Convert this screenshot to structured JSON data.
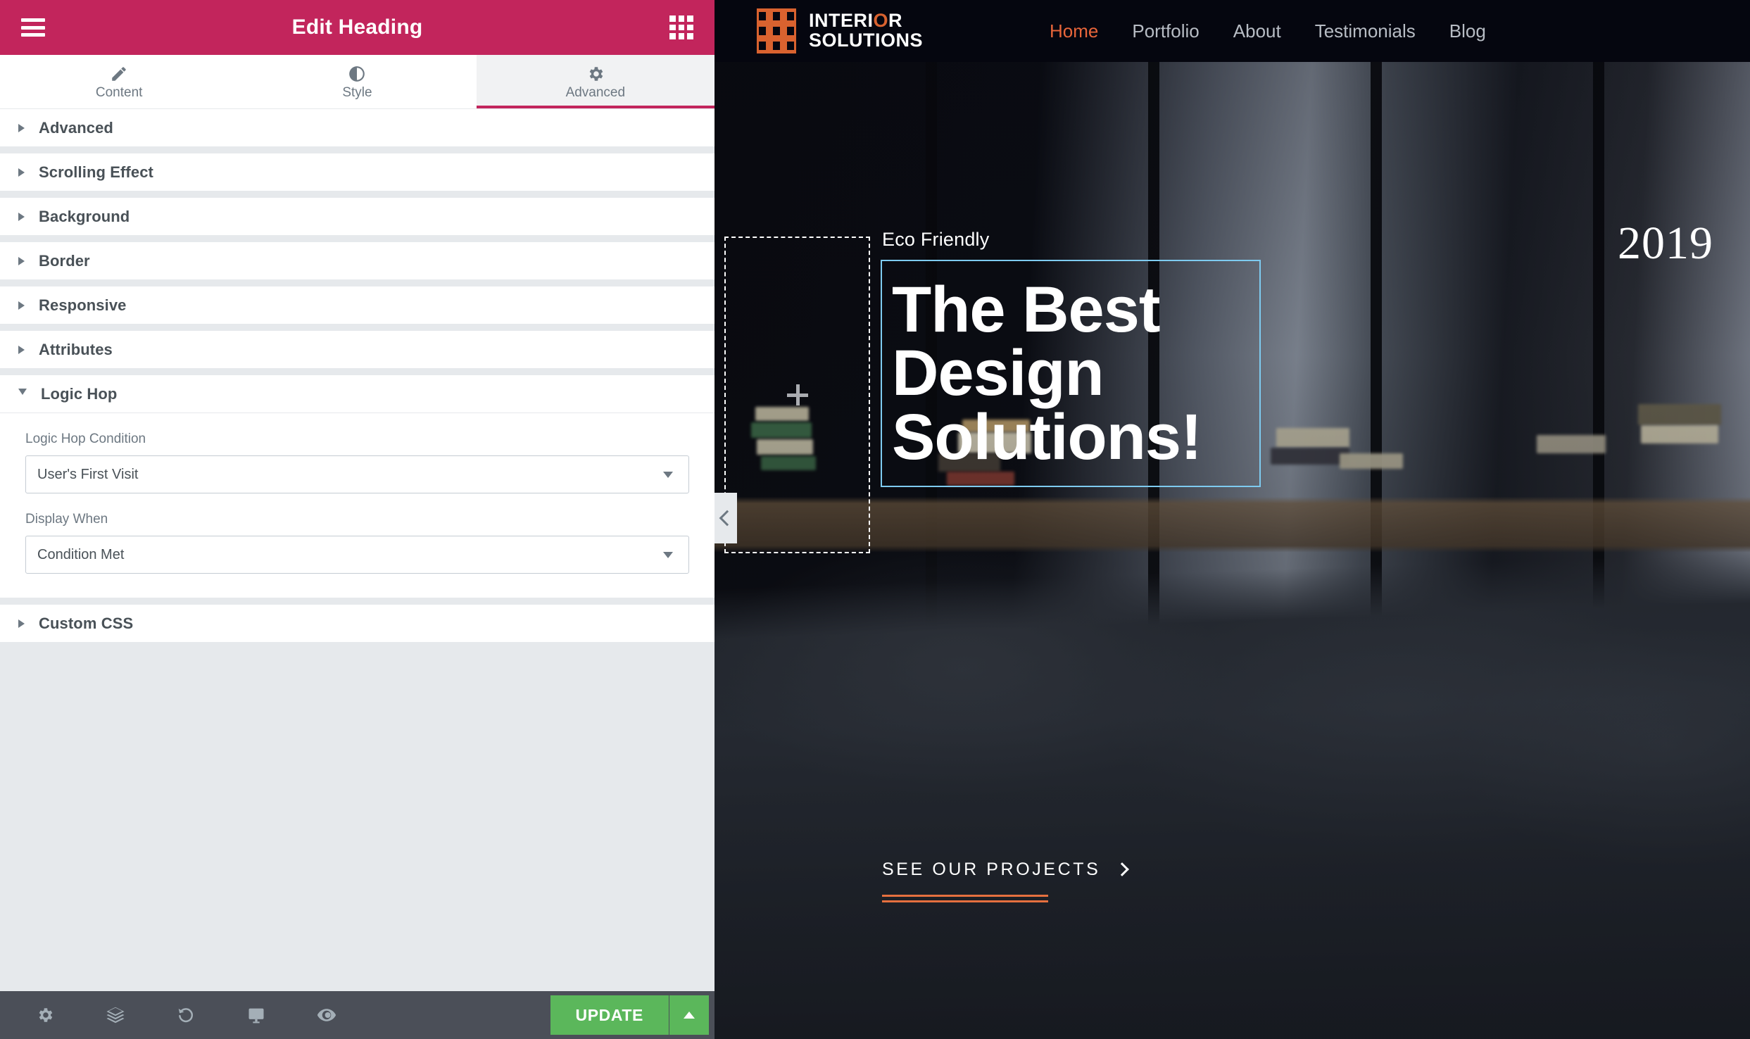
{
  "panel": {
    "title": "Edit Heading",
    "menu_icon": "hamburger-icon",
    "widgets_icon": "grid-icon",
    "tabs": [
      {
        "label": "Content",
        "icon": "pencil-icon",
        "active": false
      },
      {
        "label": "Style",
        "icon": "contrast-icon",
        "active": false
      },
      {
        "label": "Advanced",
        "icon": "gear-icon",
        "active": true
      }
    ],
    "sections": [
      {
        "label": "Advanced",
        "open": false
      },
      {
        "label": "Scrolling Effect",
        "open": false
      },
      {
        "label": "Background",
        "open": false
      },
      {
        "label": "Border",
        "open": false
      },
      {
        "label": "Responsive",
        "open": false
      },
      {
        "label": "Attributes",
        "open": false
      },
      {
        "label": "Logic Hop",
        "open": true
      },
      {
        "label": "Custom CSS",
        "open": false
      }
    ],
    "logic_hop": {
      "condition_label": "Logic Hop Condition",
      "condition_value": "User's First Visit",
      "display_when_label": "Display When",
      "display_when_value": "Condition Met"
    },
    "footer": {
      "icons": [
        "gear-icon",
        "layers-icon",
        "history-icon",
        "desktop-icon",
        "eye-icon"
      ],
      "update_label": "UPDATE",
      "update_arrow_icon": "caret-up-icon"
    },
    "collapse_icon": "chevron-left-icon"
  },
  "preview": {
    "brand": {
      "mark_icon": "building-windows-icon",
      "line1": "INTERI",
      "line1_o": "O",
      "line1_end": "R",
      "line2": "SOLUTIONS"
    },
    "nav": [
      {
        "label": "Home",
        "active": true
      },
      {
        "label": "Portfolio",
        "active": false
      },
      {
        "label": "About",
        "active": false
      },
      {
        "label": "Testimonials",
        "active": false
      },
      {
        "label": "Blog",
        "active": false
      }
    ],
    "hero": {
      "eyebrow": "Eco Friendly",
      "year": "2019",
      "headline": "The Best Design Solutions!",
      "cta_label": "SEE OUR PROJECTS",
      "cta_icon": "chevron-right-icon",
      "empty_column_icon": "plus-icon"
    },
    "colors": {
      "accent_orange": "#d9622f",
      "nav_active": "#e8653a",
      "selection_blue": "#7ecbf0",
      "header_bg": "#05060f"
    }
  }
}
